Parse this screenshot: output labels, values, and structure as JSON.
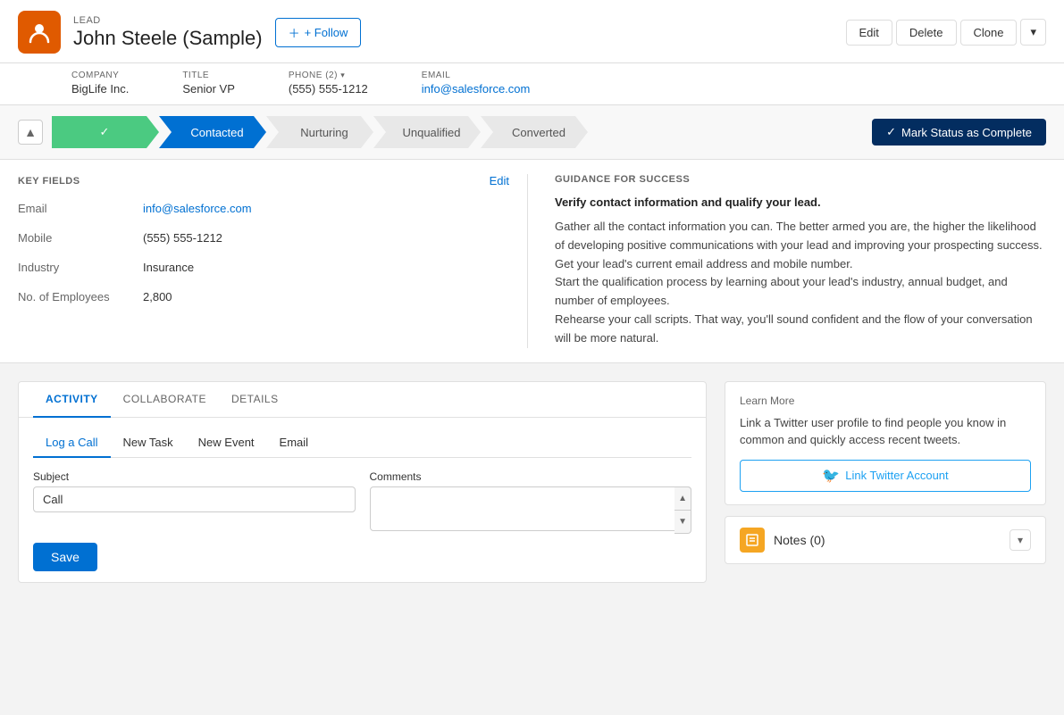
{
  "header": {
    "lead_label": "LEAD",
    "lead_name": "John Steele (Sample)",
    "follow_label": "+ Follow",
    "edit_label": "Edit",
    "delete_label": "Delete",
    "clone_label": "Clone"
  },
  "meta": {
    "company_label": "COMPANY",
    "company_value": "BigLife Inc.",
    "title_label": "TITLE",
    "title_value": "Senior VP",
    "phone_label": "PHONE (2)",
    "phone_value": "(555) 555-1212",
    "email_label": "EMAIL",
    "email_value": "info@salesforce.com"
  },
  "progress": {
    "steps": [
      {
        "label": "✓",
        "type": "complete"
      },
      {
        "label": "Contacted",
        "type": "active"
      },
      {
        "label": "Nurturing",
        "type": "inactive"
      },
      {
        "label": "Unqualified",
        "type": "inactive"
      },
      {
        "label": "Converted",
        "type": "inactive"
      }
    ],
    "mark_complete_label": "✓  Mark Status as Complete"
  },
  "key_fields": {
    "title": "KEY FIELDS",
    "edit_label": "Edit",
    "fields": [
      {
        "label": "Email",
        "value": "info@salesforce.com",
        "is_link": true
      },
      {
        "label": "Mobile",
        "value": "(555) 555-1212",
        "is_link": false
      },
      {
        "label": "Industry",
        "value": "Insurance",
        "is_link": false
      },
      {
        "label": "No. of Employees",
        "value": "2,800",
        "is_link": false
      }
    ]
  },
  "guidance": {
    "title": "GUIDANCE FOR SUCCESS",
    "heading": "Verify contact information and qualify your lead.",
    "paragraphs": [
      "Gather all the contact information you can. The better armed you are, the higher the likelihood of developing positive communications with your lead and improving your prospecting success.",
      "Get your lead's current email address and mobile number.",
      "Start the qualification process by learning about your lead's industry, annual budget, and number of employees.",
      "Rehearse your call scripts. That way, you'll sound confident and the flow of your conversation will be more natural."
    ]
  },
  "activity": {
    "tabs": [
      "ACTIVITY",
      "COLLABORATE",
      "DETAILS"
    ],
    "active_tab": "ACTIVITY",
    "call_tabs": [
      "Log a Call",
      "New Task",
      "New Event",
      "Email"
    ],
    "active_call_tab": "Log a Call",
    "subject_label": "Subject",
    "subject_value": "Call",
    "comments_label": "Comments",
    "save_label": "Save"
  },
  "twitter": {
    "learn_more": "Learn More",
    "description": "Link a Twitter user profile to find people you know in common and quickly access recent tweets.",
    "link_label": "Link Twitter Account"
  },
  "notes": {
    "title": "Notes (0)"
  }
}
